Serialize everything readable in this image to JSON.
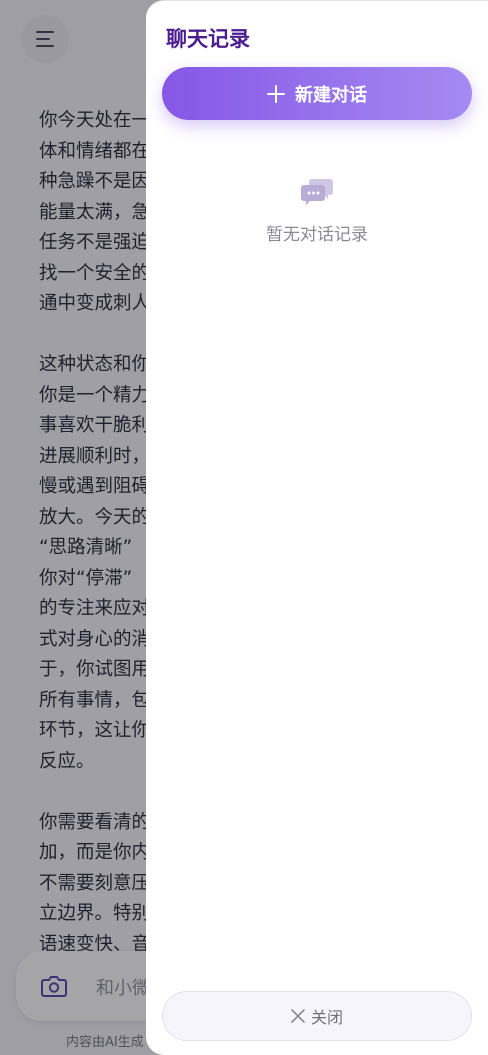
{
  "app": {
    "menu_icon": "menu-icon",
    "message_paragraphs": [
      "你今天处在一种\n体和情绪都在\n种急躁不是因\n能量太满，急\n任务不是强迫\n找一个安全的\n通中变成刺人",
      "这种状态和你\n你是一个精力\n事喜欢干脆利\n进展顺利时，\n慢或遇到阻碍\n放大。今天的\n“思路清晰”\n你对“停滞”\n的专注来应对\n式对身心的消\n于，你试图用\n所有事情，包\n环节，这让你\n反应。",
      "你需要看清的\n加，而是你内\n不需要刻意压\n立边界。特别\n语速变快、音\n没说完”的冲\n信号，此时"
    ],
    "camera_icon": "camera-icon",
    "input_placeholder": "和小微",
    "footer_note": "内容由AI生成"
  },
  "drawer": {
    "title": "聊天记录",
    "new_chat_label": "新建对话",
    "plus_icon": "plus-icon",
    "empty_icon": "chat-bubbles-icon",
    "empty_text": "暂无对话记录",
    "close_icon": "close-icon",
    "close_label": "关闭"
  },
  "colors": {
    "accent": "#8657e6",
    "accent_light": "#a58af2",
    "title": "#4b1d8f",
    "overlay": "rgba(40,40,48,0.42)"
  }
}
